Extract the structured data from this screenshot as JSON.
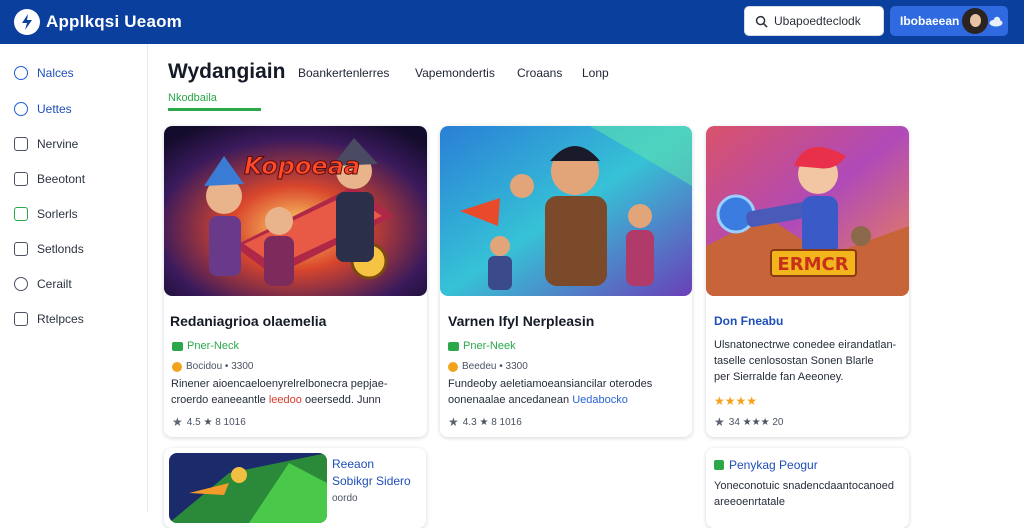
{
  "app": {
    "title": "Applkqsi Ueaom"
  },
  "search": {
    "value": "Ubapoedteclodk"
  },
  "account": {
    "label": "Ibobaeean"
  },
  "sidebar": {
    "items": [
      {
        "label": "Nalces",
        "icon": "circle-icon"
      },
      {
        "label": "Uettes",
        "icon": "gamepad-icon"
      },
      {
        "label": "Nervine",
        "icon": "square-icon"
      },
      {
        "label": "Beeotont",
        "icon": "document-icon"
      },
      {
        "label": "Sorlerls",
        "icon": "screen-icon"
      },
      {
        "label": "Setlonds",
        "icon": "expand-icon"
      },
      {
        "label": "Cerailt",
        "icon": "chat-icon"
      },
      {
        "label": "Rtelpces",
        "icon": "folder-icon"
      }
    ]
  },
  "header": {
    "title": "Wydangiain",
    "subtitle": "Nkodbaila",
    "tabs": [
      "Boankertenlerres",
      "Vapemondertis",
      "Croaans",
      "Lonp"
    ]
  },
  "cards": [
    {
      "name": "Redaniagrioa olaemelia",
      "tag": "Pner-Neck",
      "meta": "Bocidou • 3300",
      "desc_1": "Rinener aioencaeloenyrelrelbonecra pepjae-",
      "desc_2a": "croerdo eaneeantle ",
      "desc_2b": "leedoo",
      "desc_2c": " oeersedd. Junn",
      "stats": "4.5 ★ 8 1016",
      "art_badge": "Kopoeaa"
    },
    {
      "name": "Varnen lfyl Nerpleasin",
      "tag": "Pner-Neek",
      "meta": "Beedeu • 3300",
      "desc_1": "Fundeoby aeletiamoeansiancilar oterodes",
      "desc_2a": "oonenaalae ancedanean ",
      "desc_2b": "Uedabocko",
      "stats": "4.3 ★ 8 1016"
    },
    {
      "name": "Don Fneabu",
      "desc_1": "Ulsnatonectrwe conedee eirandatlan-",
      "desc_2": "taselle cenlosostan Sonen Blarle",
      "desc_3": "per Sierralde fan Aeeoney.",
      "stats": "34 ★★★ 20",
      "art_badge": "ERMCR"
    },
    {
      "name_1": "Reeaon",
      "name_2": "Sobikgr Sidero",
      "name_3": "oordo"
    },
    {
      "name": "Penykag Peogur",
      "desc_1": "Yoneconotuic snadencdaantocanoed",
      "desc_2": "areeoenrtatale"
    }
  ],
  "colors": {
    "topbar": "#0b3f9e",
    "accent_green": "#2aa84a",
    "accent_blue": "#2f6ae0"
  }
}
